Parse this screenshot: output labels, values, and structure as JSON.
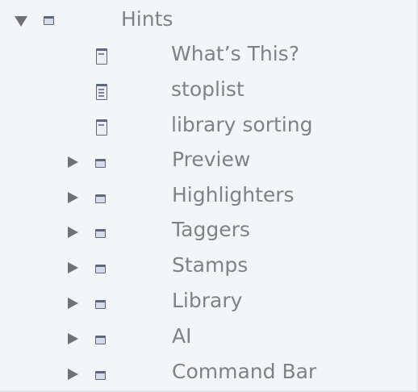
{
  "tree": {
    "root": {
      "label": "Hints",
      "expanded": true,
      "icon": "folder-icon"
    },
    "notes": [
      {
        "label": "What’s This?",
        "icon": "note-icon"
      },
      {
        "label": "stoplist",
        "icon": "note-icon"
      },
      {
        "label": "library sorting",
        "icon": "note-icon"
      }
    ],
    "folders": [
      {
        "label": "Preview",
        "expanded": false,
        "icon": "folder-icon"
      },
      {
        "label": "Highlighters",
        "expanded": false,
        "icon": "folder-icon"
      },
      {
        "label": "Taggers",
        "expanded": false,
        "icon": "folder-icon"
      },
      {
        "label": "Stamps",
        "expanded": false,
        "icon": "folder-icon"
      },
      {
        "label": "Library",
        "expanded": false,
        "icon": "folder-icon"
      },
      {
        "label": "AI",
        "expanded": false,
        "icon": "folder-icon"
      },
      {
        "label": "Command Bar",
        "expanded": false,
        "icon": "folder-icon"
      }
    ]
  }
}
